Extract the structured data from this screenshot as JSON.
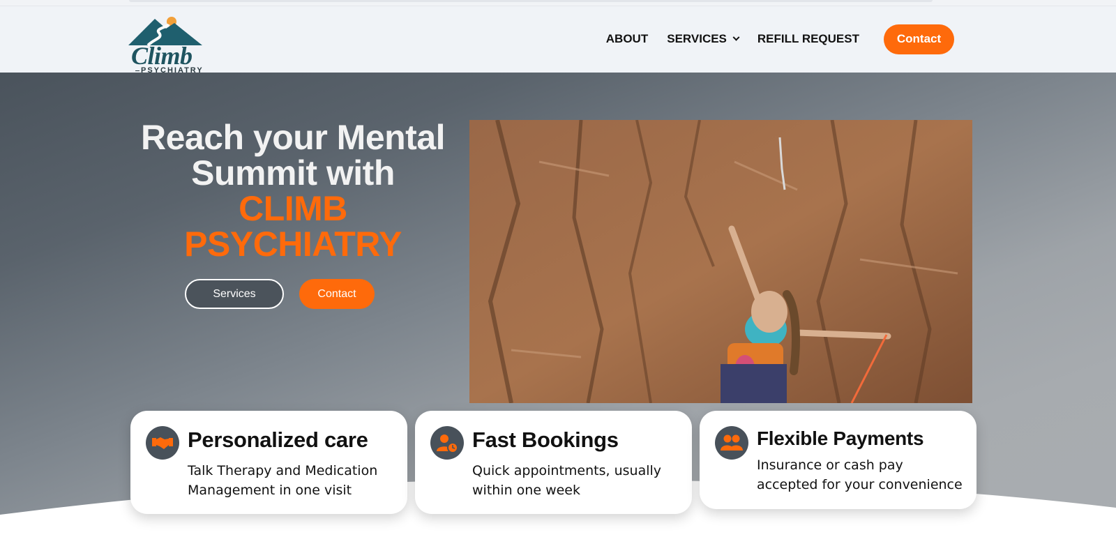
{
  "brand": {
    "logo_word": "Climb",
    "logo_sub": "PSYCHIATRY",
    "colors": {
      "accent": "#fe6a0b",
      "teal": "#1f5460",
      "dark": "#48515a"
    }
  },
  "nav": {
    "items": [
      {
        "label": "ABOUT"
      },
      {
        "label": "SERVICES"
      },
      {
        "label": "REFILL REQUEST"
      }
    ],
    "contact_label": "Contact"
  },
  "hero": {
    "headline_line1": "Reach your Mental",
    "headline_line2": "Summit with",
    "headline_accent1": "CLIMB",
    "headline_accent2": "PSYCHIATRY",
    "services_button": "Services",
    "contact_button": "Contact"
  },
  "features": [
    {
      "title": "Personalized care",
      "text": "Talk Therapy and Medication Management in one visit",
      "icon": "handshake-icon"
    },
    {
      "title": "Fast Bookings",
      "text": "Quick appointments, usually within one week",
      "icon": "user-clock-icon"
    },
    {
      "title": "Flexible Payments",
      "text": "Insurance or cash pay accepted for your convenience",
      "icon": "users-icon"
    }
  ]
}
